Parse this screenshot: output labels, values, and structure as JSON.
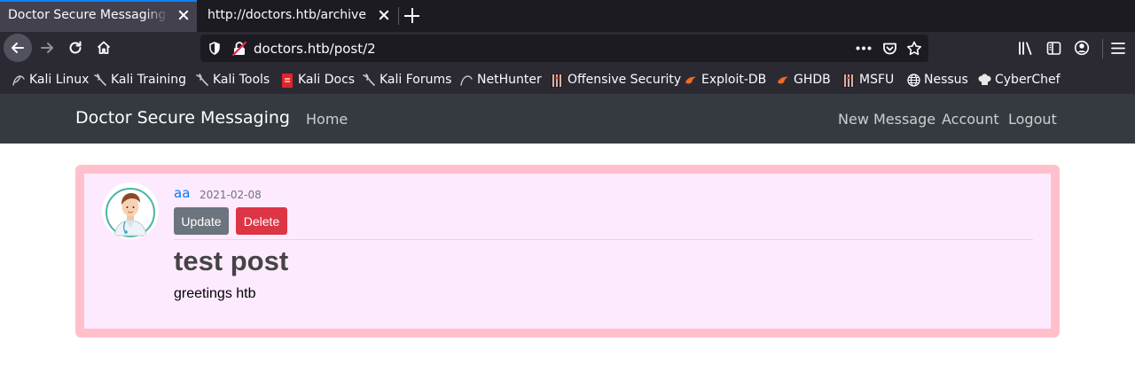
{
  "browser": {
    "tabs": [
      {
        "title": "Doctor Secure Messaging - t",
        "active": true
      },
      {
        "title": "http://doctors.htb/archive",
        "active": false
      }
    ],
    "url": "doctors.htb/post/2",
    "bookmarks": [
      {
        "label": "Kali Linux",
        "icon": "kali-dragon-icon"
      },
      {
        "label": "Kali Training",
        "icon": "kali-dragon-icon"
      },
      {
        "label": "Kali Tools",
        "icon": "kali-dragon-icon"
      },
      {
        "label": "Kali Docs",
        "icon": "kali-docs-icon"
      },
      {
        "label": "Kali Forums",
        "icon": "kali-dragon-icon"
      },
      {
        "label": "NetHunter",
        "icon": "nethunter-icon"
      },
      {
        "label": "Offensive Security",
        "icon": "offsec-icon"
      },
      {
        "label": "Exploit-DB",
        "icon": "exploitdb-icon"
      },
      {
        "label": "GHDB",
        "icon": "exploitdb-icon"
      },
      {
        "label": "MSFU",
        "icon": "offsec-icon"
      },
      {
        "label": "Nessus",
        "icon": "globe-icon"
      },
      {
        "label": "CyberChef",
        "icon": "chef-hat-icon"
      }
    ],
    "colors": {
      "tab_bar": "#1c1b22",
      "toolbar": "#2b2a33",
      "active_tab": "#42414d",
      "accent": "#0a84ff"
    }
  },
  "site": {
    "brand": "Doctor Secure Messaging",
    "nav_left": [
      "Home"
    ],
    "nav_right": [
      "New Message",
      "Account",
      "Logout"
    ],
    "colors": {
      "navbar": "#343a40",
      "card_bg": "#feeaff",
      "card_border": "#ffc0cb"
    }
  },
  "post": {
    "author": "aa",
    "date": "2021-02-08",
    "update_label": "Update",
    "delete_label": "Delete",
    "title": "test post",
    "body": "greetings htb"
  }
}
